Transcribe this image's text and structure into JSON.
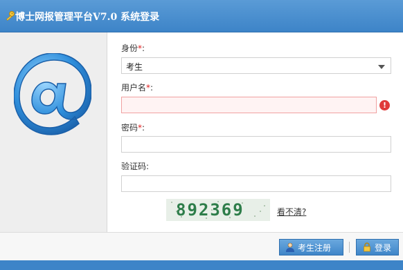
{
  "window": {
    "title": "博士网报管理平台V7.0 系统登录",
    "title_icon": "key-icon"
  },
  "logo": {
    "name": "at-sign-icon"
  },
  "form": {
    "identity": {
      "label": "身份",
      "required_mark": "*",
      "separator": ":",
      "selected": "考生"
    },
    "username": {
      "label": "用户名",
      "required_mark": "*",
      "separator": ":",
      "value": "",
      "error_icon": "!"
    },
    "password": {
      "label": "密码",
      "required_mark": "*",
      "separator": ":",
      "value": ""
    },
    "captcha_field": {
      "label": "验证码",
      "separator": ":",
      "value": ""
    },
    "captcha": {
      "code": "892369",
      "refresh_link": "看不清?"
    }
  },
  "footer": {
    "register_label": "考生注册",
    "login_label": "登录"
  },
  "colors": {
    "accent": "#3d84c8",
    "required": "#e02020",
    "error": "#e03a3a"
  }
}
